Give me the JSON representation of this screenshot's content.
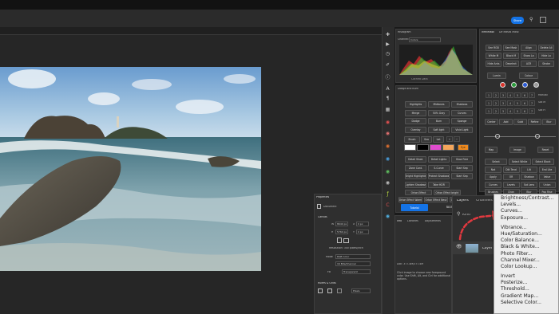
{
  "header": {
    "share_label": "Share"
  },
  "histogram": {
    "tab": "Histogram",
    "channel_label": "Channel:",
    "channel_value": "Colors",
    "warning": "Cached Data"
  },
  "dodge_burn": {
    "title": "Dodge and Burn",
    "rows": [
      [
        "Highlights",
        "Midtones",
        "Shadows"
      ],
      [
        "Merge",
        "50% Gray",
        "Curves"
      ],
      [
        "Dodge",
        "Burn",
        "Sponge"
      ],
      [
        "Overlay",
        "Soft light",
        "Vivid Light"
      ]
    ],
    "brush_label": "Brush",
    "sna_label": "Sna",
    "lat_label": "Lat",
    "eye_label": "Eye",
    "rows2": [
      [
        "Detail Shad.",
        "Detail Lights",
        "Glow Free"
      ],
      [
        "Zone Cont.",
        "S-Curve",
        "Start Sep"
      ],
      [
        "Bright Highlights",
        "Protect Shadows",
        "Start Sep"
      ],
      [
        "Lighten Shadows",
        "Take HDR",
        ""
      ]
    ],
    "row3": [
      "Orton Effect",
      "Orton Effect bright"
    ],
    "row4": [
      "Orton Effect Warm",
      "Orton Effect Neut",
      "Orton Effect Cool"
    ],
    "tutorial_label": "Tutorial",
    "tools_label": "Tools"
  },
  "infinimask": {
    "tab1": "InfiniMask",
    "tab2": "Dif Masks Mask",
    "rows": [
      [
        "See RGB",
        "See Mask",
        "Align",
        "Delete All"
      ],
      [
        "White M",
        "Black M",
        "Show La",
        "Hide La"
      ],
      [
        "Hide Ants",
        "Deselect",
        "ACR",
        "Stroke"
      ]
    ],
    "lumin_label": "Lumin",
    "colour_label": "Colour",
    "right_labels": [
      "Manual",
      "Sat M",
      "Sat H"
    ],
    "mid_labels": [
      "Center",
      "Add",
      "Subt",
      "Refine",
      "Blur"
    ],
    "map_labels": [
      "Map",
      "Image",
      "Reset"
    ],
    "select_rows": [
      [
        "Select",
        "Select White",
        "Select Black"
      ],
      [
        "Not",
        "Dilt Tend",
        "Lilt",
        "End Lite"
      ],
      [
        "Apply",
        "OR",
        "Shadow",
        "Value"
      ],
      [
        "Curves",
        "Levels",
        "Sat Lens",
        "Union"
      ],
      [
        "Brushes",
        "Chan",
        "Blur",
        "Pop Rise"
      ]
    ]
  },
  "properties": {
    "title": "Properties",
    "doc_label": "Document",
    "canvas_label": "Canvas",
    "w_label": "W",
    "h_label": "H",
    "w_value": "8640 px",
    "h_value": "5760 px",
    "x_label": "X",
    "y_label": "Y",
    "x_value": "0 px",
    "y_value": "0 px",
    "resolution": "Resolution: 300 pixels/inch",
    "mode_label": "Mode",
    "mode_value": "RGB Color",
    "bits_value": "16 Bits/Channel",
    "fill_label": "Fill",
    "fill_value": "Transparent",
    "rulers_label": "Rulers & Grids",
    "units_value": "Pixels"
  },
  "info_panel": {
    "tabs": [
      "Info",
      "Libraries",
      "Adjustments"
    ],
    "lines": [
      "Doc: 377.4M/377.4M",
      "Click image to choose new foreground color. Use Shift, Alt, and Ctrl for additional options."
    ]
  },
  "layers": {
    "tabs": [
      "Layers",
      "Channels"
    ],
    "kind_label": "Kind",
    "layer_name": "Layer"
  },
  "context_menu": {
    "groups": [
      [
        "Brightness/Contrast...",
        "Levels...",
        "Curves...",
        "Exposure..."
      ],
      [
        "Vibrance...",
        "Hue/Saturation...",
        "Color Balance...",
        "Black & White...",
        "Photo Filter...",
        "Channel Mixer...",
        "Color Lookup..."
      ],
      [
        "Invert",
        "Posterize...",
        "Threshold...",
        "Gradient Map...",
        "Selective Color..."
      ]
    ]
  },
  "colors": {
    "accent": "#1473e6",
    "arrow": "#e2393f",
    "swatches": [
      "#ffffff",
      "#000000",
      "#e04ccf",
      "#f5a65b",
      "#f08a1e"
    ],
    "circles": [
      "#d8332b",
      "#2a9d3b",
      "#2b5bd6",
      "#9a9a9a"
    ]
  }
}
